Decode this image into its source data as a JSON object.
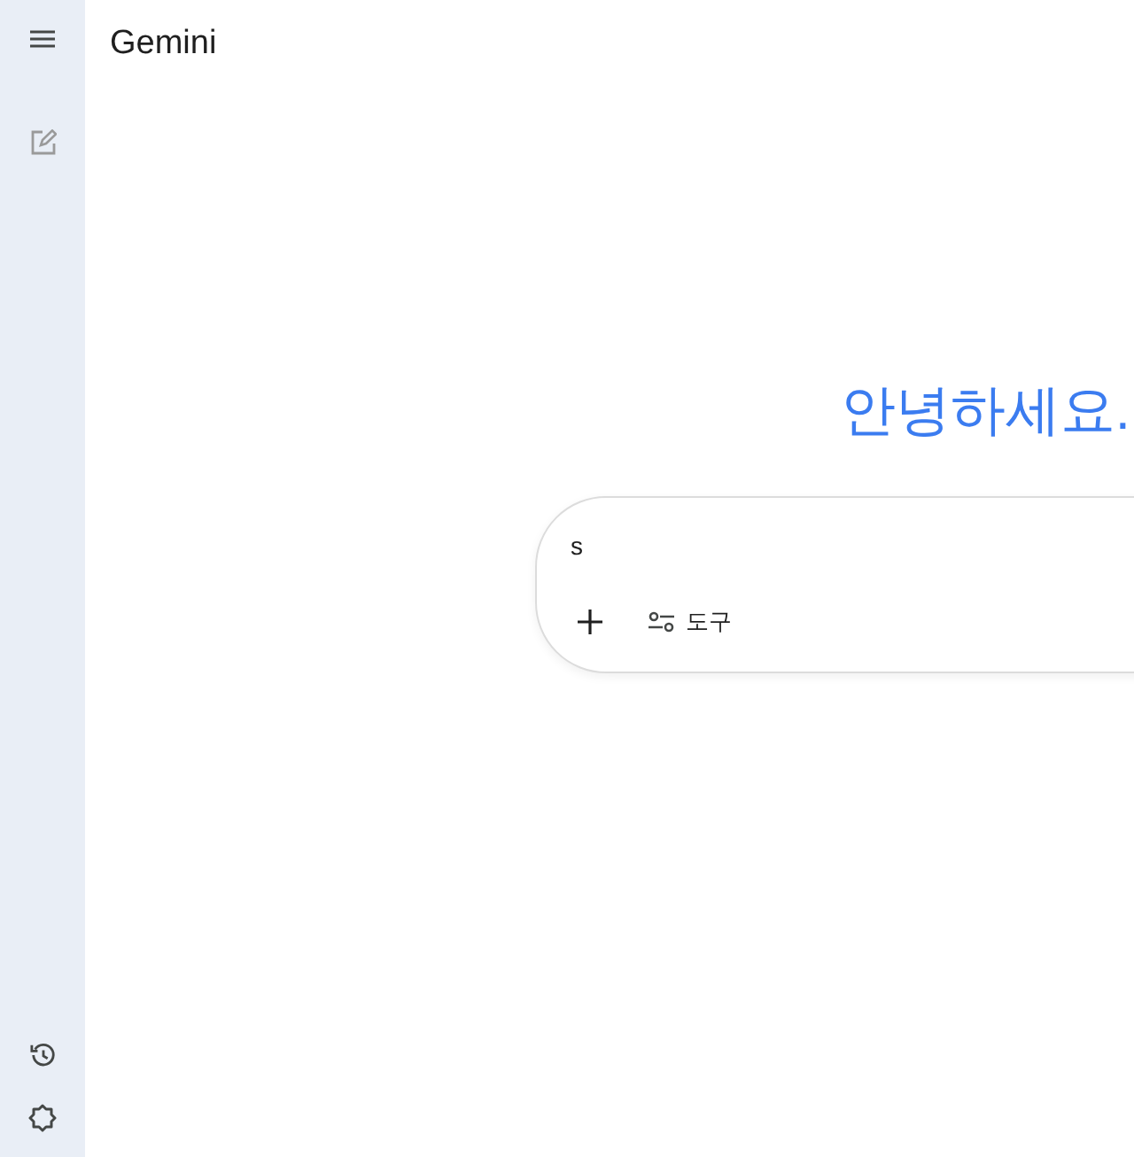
{
  "app_title": "Gemini",
  "greeting": "안녕하세요.",
  "prompt": {
    "value": "s",
    "tools_label": "도구"
  }
}
